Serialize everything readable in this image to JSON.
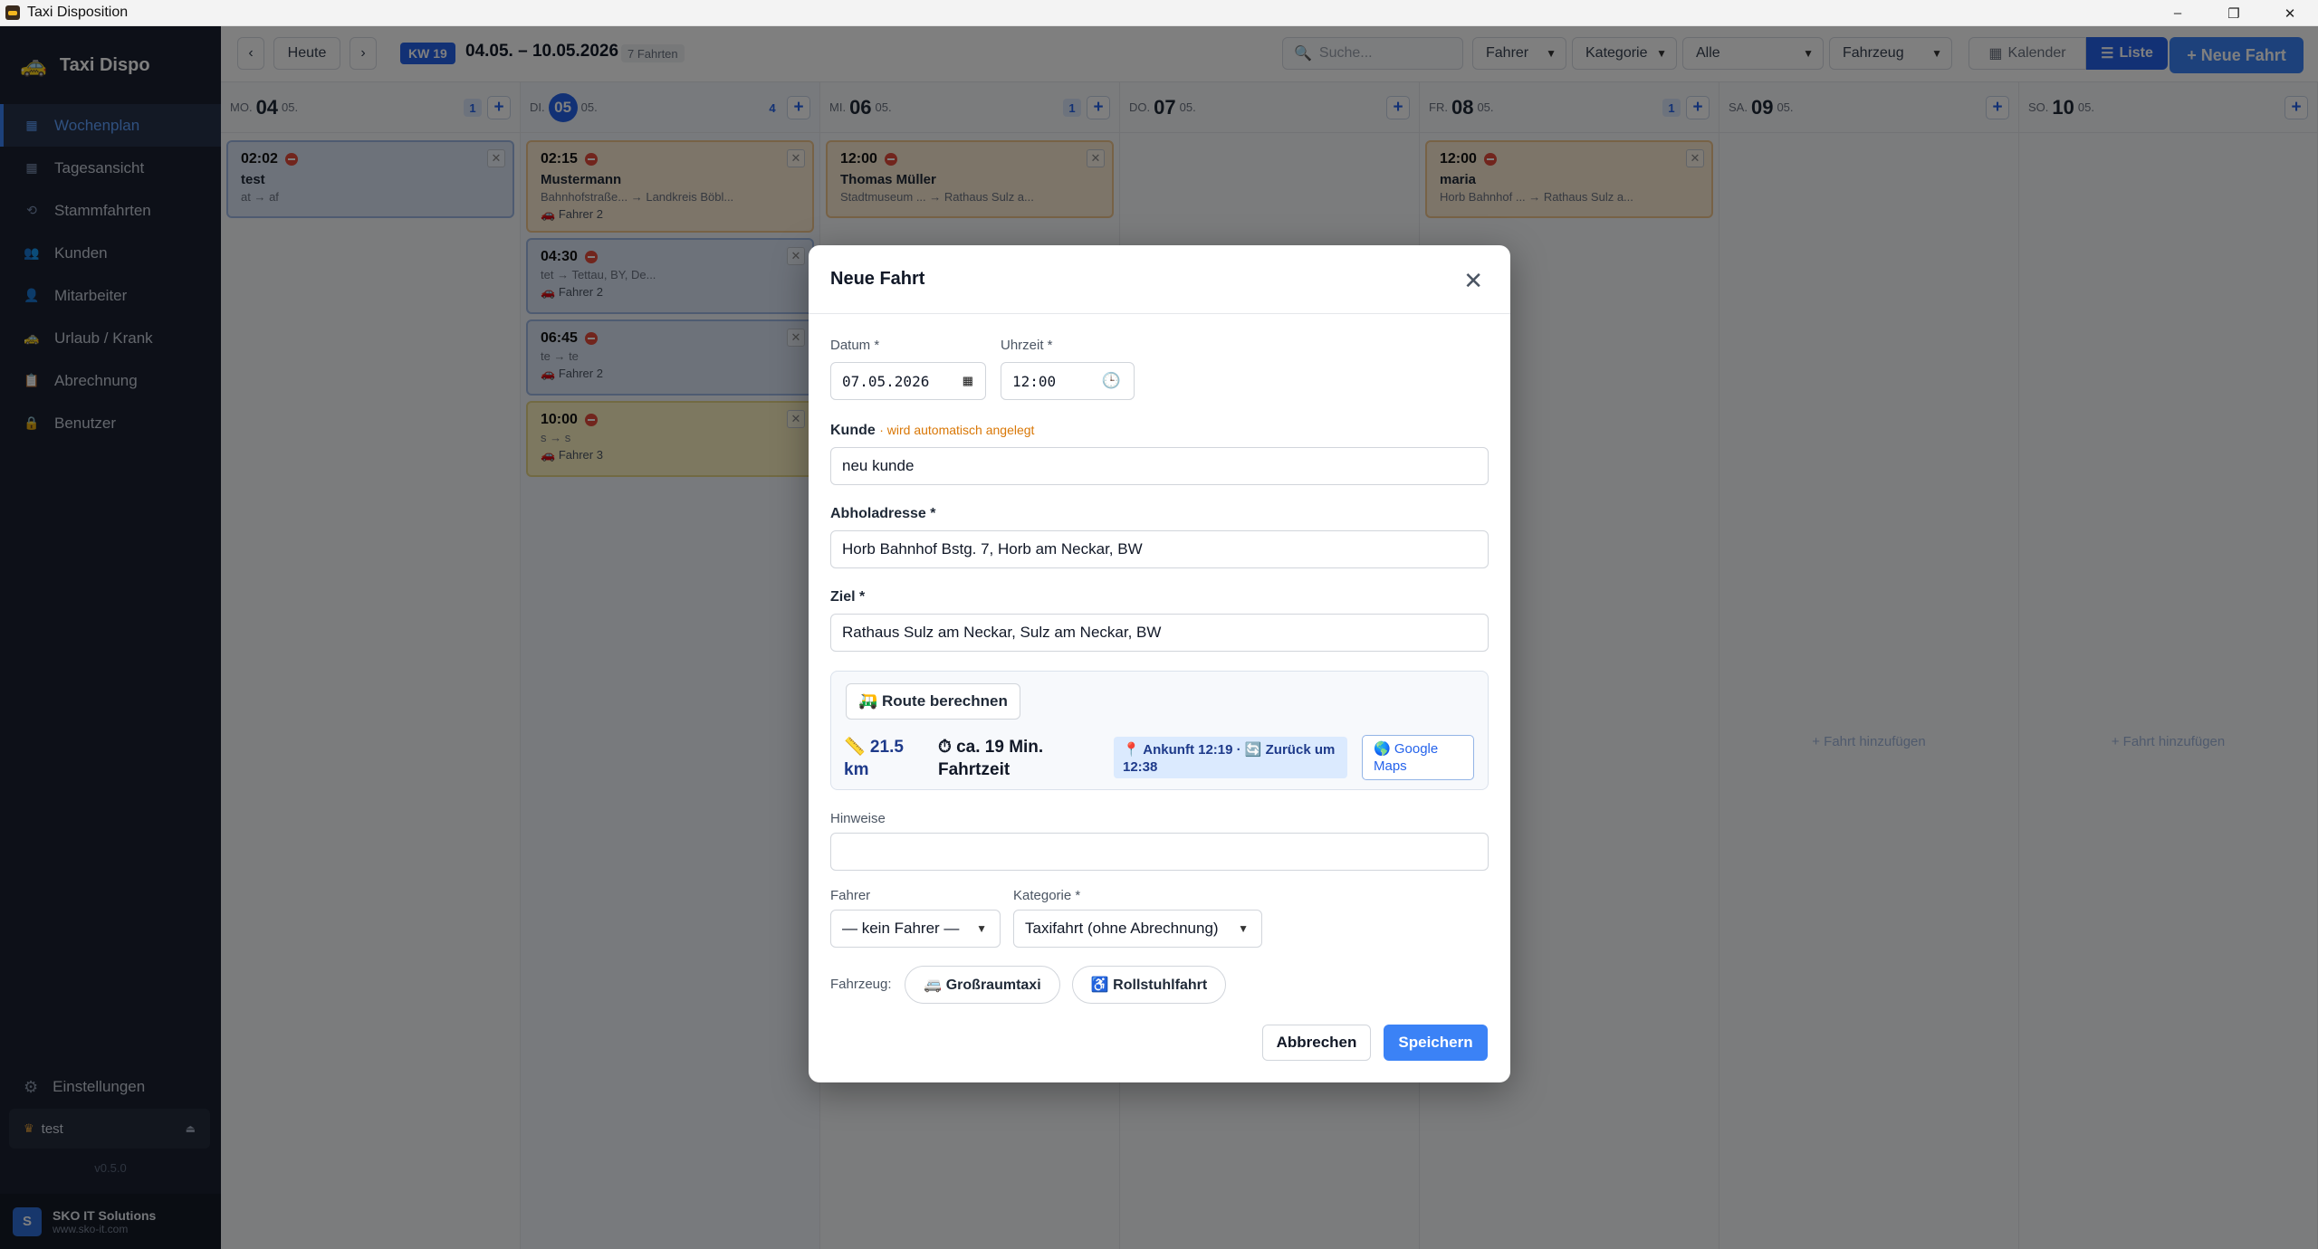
{
  "window": {
    "title": "Taxi Disposition",
    "controls": [
      "–",
      "❐",
      "✕"
    ]
  },
  "sidebar": {
    "brand": "Taxi Dispo",
    "items": [
      {
        "label": "Wochenplan",
        "icon": "calendar-icon",
        "glyph": "▦",
        "active": true
      },
      {
        "label": "Tagesansicht",
        "icon": "calendar-day-icon",
        "glyph": "▦"
      },
      {
        "label": "Stammfahrten",
        "icon": "repeat-icon",
        "glyph": "⟲"
      },
      {
        "label": "Kunden",
        "icon": "users-icon",
        "glyph": "👥"
      },
      {
        "label": "Mitarbeiter",
        "icon": "person-icon",
        "glyph": "👤"
      },
      {
        "label": "Urlaub / Krank",
        "icon": "vacation-icon",
        "glyph": "🚕"
      },
      {
        "label": "Abrechnung",
        "icon": "invoice-icon",
        "glyph": "📋"
      },
      {
        "label": "Benutzer",
        "icon": "lock-icon",
        "glyph": "🔒"
      }
    ],
    "settings": "Einstellungen",
    "user": "test",
    "version": "v0.5.0",
    "company_name": "SKO IT Solutions",
    "company_url": "www.sko-it.com",
    "company_logo_letter": "S"
  },
  "toolbar": {
    "prev": "‹",
    "today": "Heute",
    "next": "›",
    "week": "KW 19",
    "range": "04.05. – 10.05.2026",
    "trips": "7 Fahrten",
    "search_placeholder": "Suche...",
    "filters": {
      "driver": "Fahrer",
      "category": "Kategorie",
      "status": "Alle",
      "vehicle": "Fahrzeug"
    },
    "view_calendar": "Kalender",
    "view_list": "Liste",
    "new_trip": "+ Neue Fahrt"
  },
  "week": {
    "days": [
      {
        "name": "MO.",
        "num": "04",
        "month": "05.",
        "count": "1"
      },
      {
        "name": "DI.",
        "num": "05",
        "month": "05.",
        "count": "4",
        "today": true
      },
      {
        "name": "MI.",
        "num": "06",
        "month": "05.",
        "count": "1"
      },
      {
        "name": "DO.",
        "num": "07",
        "month": "05.",
        "count": ""
      },
      {
        "name": "FR.",
        "num": "08",
        "month": "05.",
        "count": "1"
      },
      {
        "name": "SA.",
        "num": "09",
        "month": "05.",
        "count": ""
      },
      {
        "name": "SO.",
        "num": "10",
        "month": "05.",
        "count": ""
      }
    ],
    "add_hint": "+ Fahrt hinzufügen",
    "cards": [
      {
        "day": 0,
        "time": "02:02",
        "name": "test",
        "route": "at → af",
        "driver": "",
        "color": "blue"
      },
      {
        "day": 1,
        "time": "02:15",
        "name": "Mustermann",
        "route": "Bahnhofstraße... → Landkreis Böbl...",
        "driver": "Fahrer 2",
        "color": "orange"
      },
      {
        "day": 1,
        "time": "04:30",
        "name": "",
        "route": "tet → Tettau, BY, De...",
        "driver": "Fahrer 2",
        "color": "blue"
      },
      {
        "day": 1,
        "time": "06:45",
        "name": "",
        "route": "te → te",
        "driver": "Fahrer 2",
        "color": "blue"
      },
      {
        "day": 1,
        "time": "10:00",
        "name": "",
        "route": "s → s",
        "driver": "Fahrer 3",
        "color": "yellow"
      },
      {
        "day": 2,
        "time": "12:00",
        "name": "Thomas Müller",
        "route": "Stadtmuseum ... → Rathaus Sulz a...",
        "driver": "",
        "color": "orange"
      },
      {
        "day": 4,
        "time": "12:00",
        "name": "maria",
        "route": "Horb Bahnhof ... → Rathaus Sulz a...",
        "driver": "",
        "color": "orange"
      }
    ]
  },
  "modal": {
    "title": "Neue Fahrt",
    "date_label": "Datum *",
    "date_value": "07.05.2026",
    "time_label": "Uhrzeit *",
    "time_value": "12:00",
    "customer_label": "Kunde",
    "customer_note": "· wird automatisch angelegt",
    "customer_value": "neu kunde",
    "pickup_label": "Abholadresse *",
    "pickup_value": "Horb Bahnhof Bstg. 7, Horb am Neckar, BW",
    "dest_label": "Ziel *",
    "dest_value": "Rathaus Sulz am Neckar, Sulz am Neckar, BW",
    "route_button": "🛺 Route berechnen",
    "distance": "📏 21.5 km",
    "duration": "⏱ ca. 19 Min. Fahrtzeit",
    "arrival": "📍 Ankunft 12:19 · 🔄 Zurück um 12:38",
    "maps_button": "🌎 Google Maps",
    "notes_label": "Hinweise",
    "notes_value": "",
    "driver_label": "Fahrer",
    "driver_value": "— kein Fahrer —",
    "category_label": "Kategorie *",
    "category_value": "Taxifahrt (ohne Abrechnung)",
    "vehicle_label": "Fahrzeug:",
    "vehicle_large": "🚐 Großraumtaxi",
    "vehicle_wheelchair": "♿ Rollstuhlfahrt",
    "cancel": "Abbrechen",
    "save": "Speichern"
  },
  "colors": {
    "accent": "#3b82f6",
    "sidebar": "#1b2130",
    "orange_card": "#fbead3",
    "blue_card": "#dbe5f5",
    "yellow_card": "#fbf1c0"
  }
}
